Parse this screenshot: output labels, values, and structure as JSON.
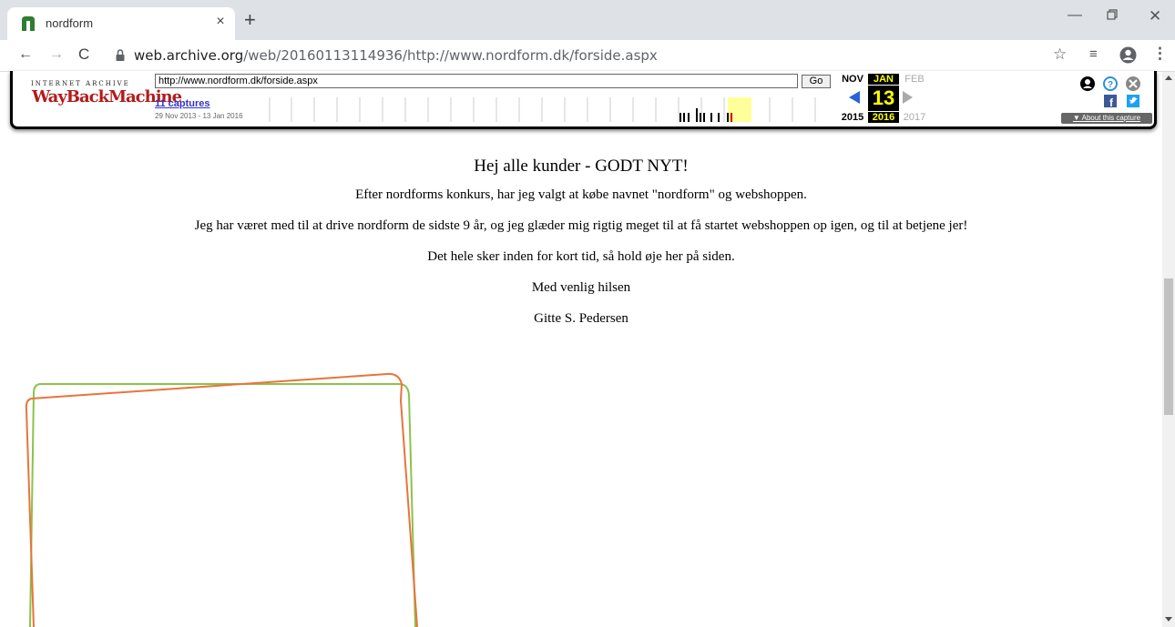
{
  "browser": {
    "tab_title": "nordform",
    "tab_close": "×",
    "new_tab": "+",
    "url_host": "web.archive.org",
    "url_path": "/web/20160113114936/http://www.nordform.dk/forside.aspx"
  },
  "wayback": {
    "logo_top": "INTERNET ARCHIVE",
    "logo": "WayBackMachine",
    "url_value": "http://www.nordform.dk/forside.aspx",
    "go_label": "Go",
    "captures": "11 captures",
    "range": "29 Nov 2013 - 13 Jan 2016",
    "months": {
      "prev": "NOV",
      "current": "JAN",
      "next": "FEB"
    },
    "day": "13",
    "years": {
      "prev": "2015",
      "current": "2016",
      "next": "2017"
    },
    "about": "▼ About this capture"
  },
  "page": {
    "heading": "Hej alle kunder - GODT NYT!",
    "paragraphs": [
      "Efter nordforms konkurs, har jeg valgt at købe navnet \"nordform\" og webshoppen.",
      "Jeg har været med til at drive nordform de sidste 9 år, og jeg glæder mig rigtig meget til at få startet webshoppen op igen, og til at betjene jer!",
      "Det hele sker inden for kort tid, så hold øje her på siden.",
      "Med venlig hilsen",
      "Gitte S. Pedersen"
    ]
  },
  "colors": {
    "favicon": "#2e7d32",
    "frame_green": "#8bc34a",
    "frame_orange": "#e8743b",
    "wayback_red": "#b31b1b",
    "current_highlight": "#ffff00"
  }
}
